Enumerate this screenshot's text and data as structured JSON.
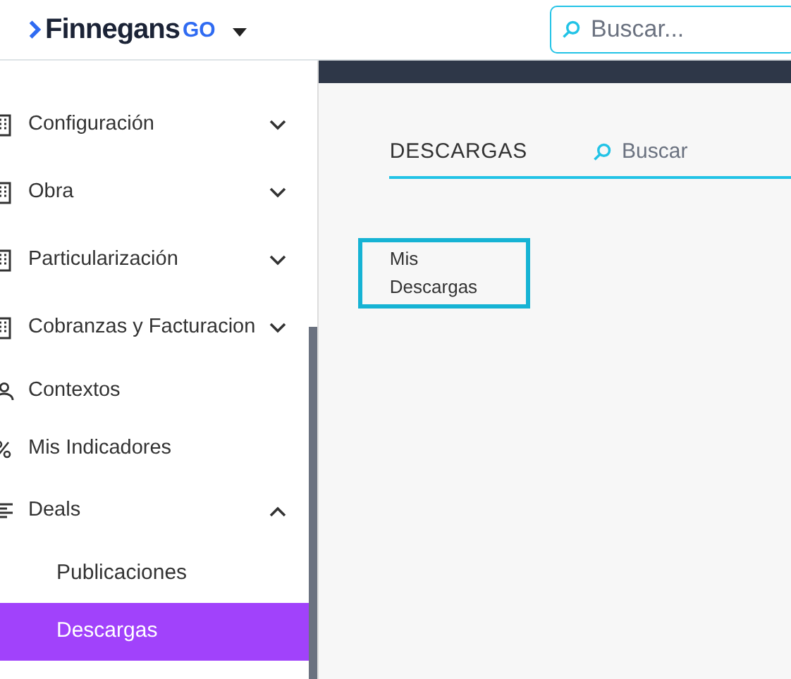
{
  "header": {
    "brand": "Finnegans",
    "brand_suffix": "GO",
    "search": {
      "placeholder": "Buscar..."
    }
  },
  "sidebar": {
    "items": [
      {
        "label": "Configuración",
        "kind": "module",
        "expanded": false
      },
      {
        "label": "Obra",
        "kind": "module",
        "expanded": false
      },
      {
        "label": "Particularización",
        "kind": "module",
        "expanded": false
      },
      {
        "label": "Cobranzas y Facturacion",
        "kind": "module",
        "expanded": false
      },
      {
        "label": "Contextos",
        "kind": "person"
      },
      {
        "label": "Mis Indicadores",
        "kind": "percent"
      },
      {
        "label": "Deals",
        "kind": "list",
        "expanded": true,
        "children": [
          {
            "label": "Publicaciones",
            "selected": false
          },
          {
            "label": "Descargas",
            "selected": true
          }
        ]
      }
    ]
  },
  "main": {
    "title": "DESCARGAS",
    "search": {
      "placeholder": "Buscar"
    },
    "cards": [
      {
        "label": "Mis Descargas"
      }
    ]
  }
}
